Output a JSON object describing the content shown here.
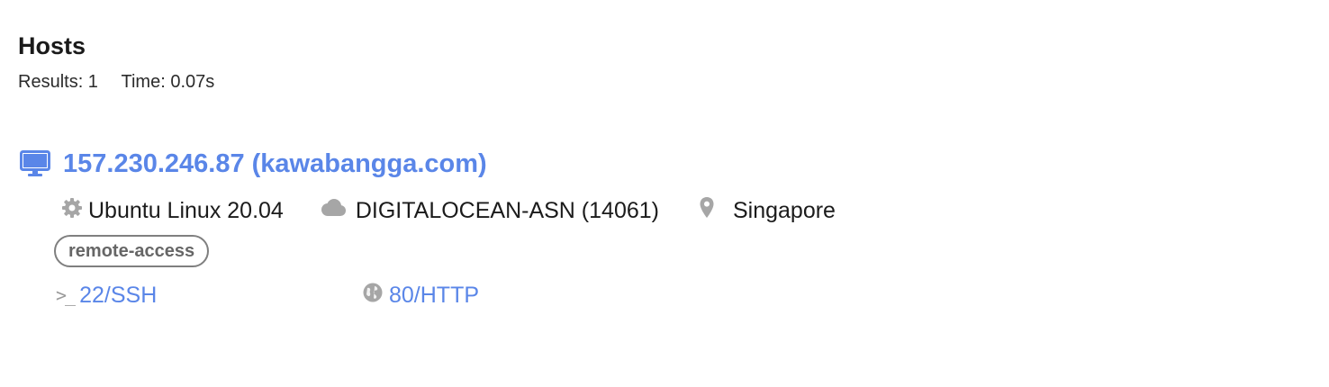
{
  "header": {
    "title": "Hosts",
    "results_label": "Results: 1",
    "time_label": "Time: 0.07s"
  },
  "host": {
    "icon": "monitor-icon",
    "link_text": "157.230.246.87 (kawabangga.com)",
    "os": {
      "icon": "gear-icon",
      "text": "Ubuntu Linux 20.04"
    },
    "asn": {
      "icon": "cloud-icon",
      "text": "DIGITALOCEAN-ASN (14061)"
    },
    "location": {
      "icon": "map-pin-icon",
      "text": "Singapore"
    },
    "tags": [
      "remote-access"
    ],
    "ports": [
      {
        "icon": "terminal-icon",
        "label": "22/SSH"
      },
      {
        "icon": "globe-icon",
        "label": "80/HTTP"
      }
    ]
  },
  "colors": {
    "link": "#5a86e8",
    "muted_icon": "#a6a6a6",
    "tag_border": "#7f7f7f",
    "text": "#1b1b1b"
  }
}
